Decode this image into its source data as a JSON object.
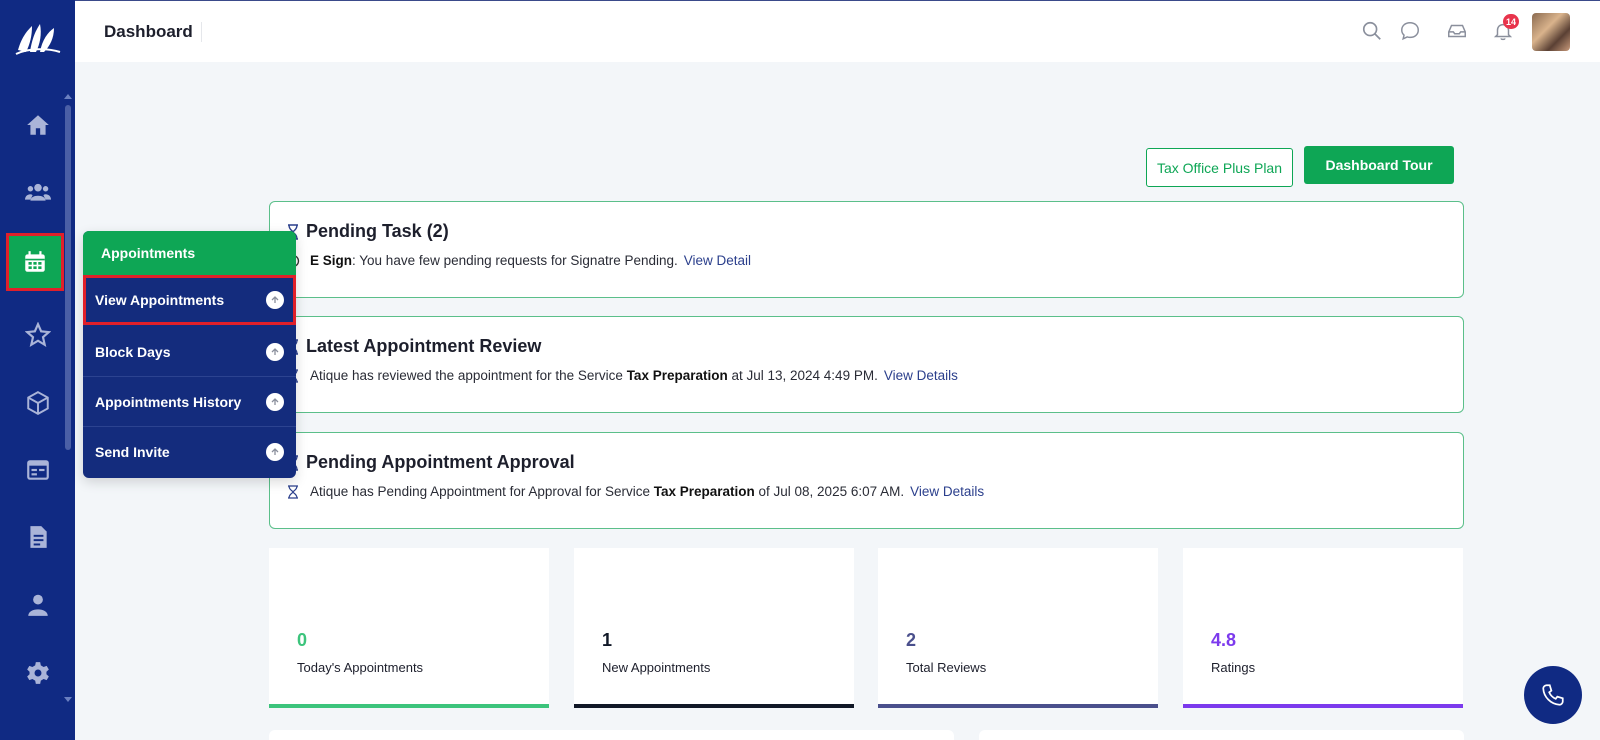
{
  "header": {
    "title": "Dashboard",
    "notification_count": "14",
    "icons": [
      "search-icon",
      "chat-icon",
      "inbox-icon",
      "bell-icon"
    ]
  },
  "sidebar": {
    "items": [
      "home-icon",
      "users-icon",
      "calendar-icon",
      "star-icon",
      "package-icon",
      "board-icon",
      "document-icon",
      "user-icon",
      "gear-icon"
    ],
    "active": "calendar-icon"
  },
  "actions": {
    "plan_label": "Tax Office Plus Plan",
    "tour_label": "Dashboard Tour"
  },
  "panels": [
    {
      "title": "Pending Task (2)",
      "lead": "E Sign",
      "text": ": You have few pending requests for Signatre Pending.",
      "bold": "",
      "tail": "",
      "link": "View Detail"
    },
    {
      "title": "Latest Appointment Review",
      "lead": "",
      "text": "Atique has reviewed the appointment for the Service ",
      "bold": "Tax Preparation",
      "tail": " at Jul 13, 2024 4:49 PM.",
      "link": "View Details"
    },
    {
      "title": "Pending Appointment Approval",
      "lead": "",
      "text": "Atique has Pending Appointment for Approval for Service ",
      "bold": "Tax Preparation",
      "tail": " of Jul 08, 2025 6:07 AM.",
      "link": "View Details"
    }
  ],
  "stats": [
    {
      "value": "0",
      "label": "Today's Appointments",
      "color": "#3cc47c"
    },
    {
      "value": "1",
      "label": "New Appointments",
      "color": "#111827"
    },
    {
      "value": "2",
      "label": "Total Reviews",
      "color": "#4a4f8c"
    },
    {
      "value": "4.8",
      "label": "Ratings",
      "color": "#7c3aed"
    }
  ],
  "menu": {
    "header": "Appointments",
    "items": [
      "View Appointments",
      "Block Days",
      "Appointments History",
      "Send Invite"
    ],
    "active": "View Appointments"
  },
  "colors": {
    "sidebar": "#102a83",
    "accent_green": "#0ea655",
    "link": "#2b3f8c"
  }
}
